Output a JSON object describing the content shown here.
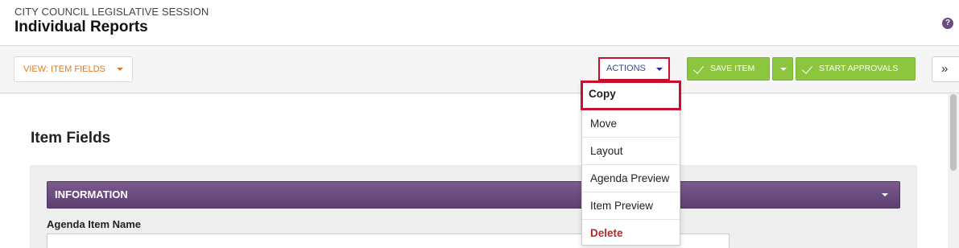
{
  "header": {
    "subtitle": "CITY COUNCIL LEGISLATIVE SESSION",
    "title": "Individual Reports",
    "help_icon": "?"
  },
  "toolbar": {
    "view_label": "VIEW: ITEM FIELDS",
    "actions_label": "ACTIONS",
    "save_label": "SAVE ITEM",
    "approvals_label": "START APPROVALS",
    "expand_glyph": "»"
  },
  "actions_menu": {
    "items": [
      {
        "label": "Copy"
      },
      {
        "label": "Move"
      },
      {
        "label": "Layout"
      },
      {
        "label": "Agenda Preview"
      },
      {
        "label": "Item Preview"
      },
      {
        "label": "Delete"
      }
    ]
  },
  "main": {
    "section_title": "Item Fields",
    "info_bar_label": "INFORMATION",
    "field_label": "Agenda Item Name",
    "field_value": ""
  },
  "colors": {
    "accent_purple": "#6b4a7c",
    "action_green": "#8cc63f",
    "highlight_red": "#c8102e",
    "view_orange": "#e07b24",
    "delete_red": "#b02a2a"
  },
  "icons": [
    "help-icon",
    "chevron-down-icon",
    "check-icon",
    "double-chevron-right-icon"
  ]
}
